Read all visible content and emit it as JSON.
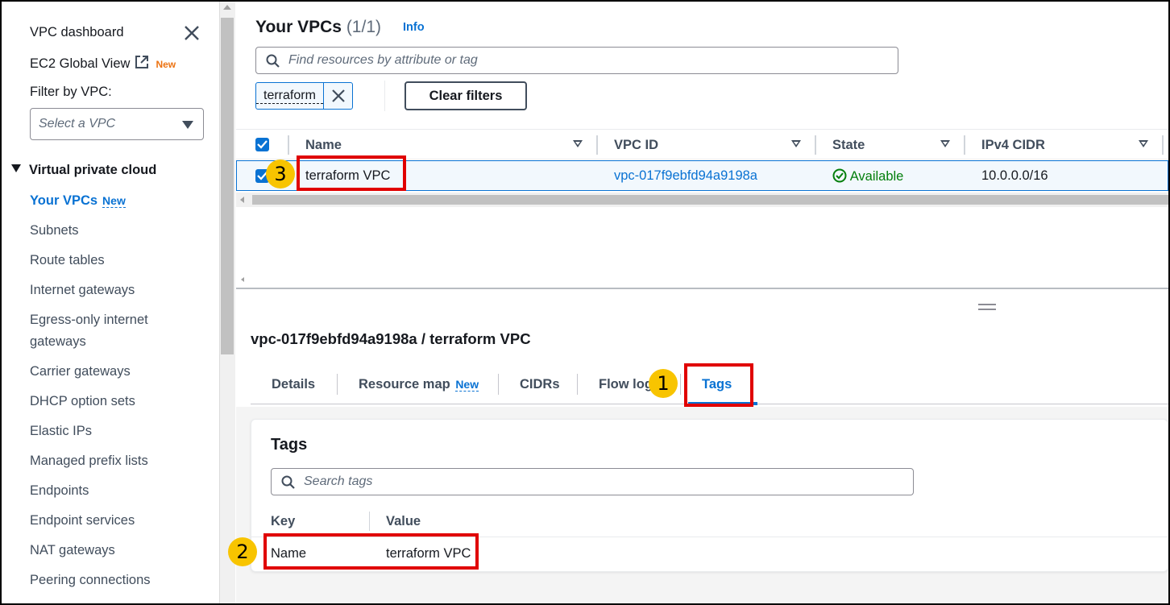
{
  "sidebar": {
    "dashboard": "VPC dashboard",
    "global_view": "EC2 Global View",
    "new_orange": "New",
    "filter_label": "Filter by VPC:",
    "select_placeholder": "Select a VPC",
    "section": "Virtual private cloud",
    "active_item": "Your VPCs",
    "active_new": "New",
    "items": [
      "Subnets",
      "Route tables",
      "Internet gateways",
      "Egress-only internet",
      "gateways",
      "Carrier gateways",
      "DHCP option sets",
      "Elastic IPs",
      "Managed prefix lists",
      "Endpoints",
      "Endpoint services",
      "NAT gateways",
      "Peering connections"
    ]
  },
  "header": {
    "title": "Your VPCs",
    "count": "(1/1)",
    "info": "Info",
    "search_placeholder": "Find resources by attribute or tag",
    "filter_token": "terraform",
    "clear_filters": "Clear filters"
  },
  "table": {
    "columns": [
      "Name",
      "VPC ID",
      "State",
      "IPv4 CIDR"
    ],
    "rows": [
      {
        "name": "terraform VPC",
        "vpc_id": "vpc-017f9ebfd94a9198a",
        "state": "Available",
        "cidr": "10.0.0.0/16"
      }
    ]
  },
  "detail": {
    "title": "vpc-017f9ebfd94a9198a / terraform VPC",
    "tabs": [
      "Details",
      "Resource map",
      "CIDRs",
      "Flow logs",
      "Tags"
    ],
    "tab_new": "New",
    "active_tab": "Tags",
    "tags_heading": "Tags",
    "tags_search_placeholder": "Search tags",
    "tags_columns": [
      "Key",
      "Value"
    ],
    "tags_rows": [
      {
        "key": "Name",
        "value": "terraform VPC"
      }
    ]
  },
  "annotations": {
    "badge_1": "1",
    "badge_2": "2",
    "badge_3": "3"
  },
  "colors": {
    "link_blue": "#0972d3",
    "success_green": "#037f0c",
    "new_orange": "#ec7211",
    "annotation_red": "#e00000",
    "badge_yellow": "#f8c400"
  }
}
